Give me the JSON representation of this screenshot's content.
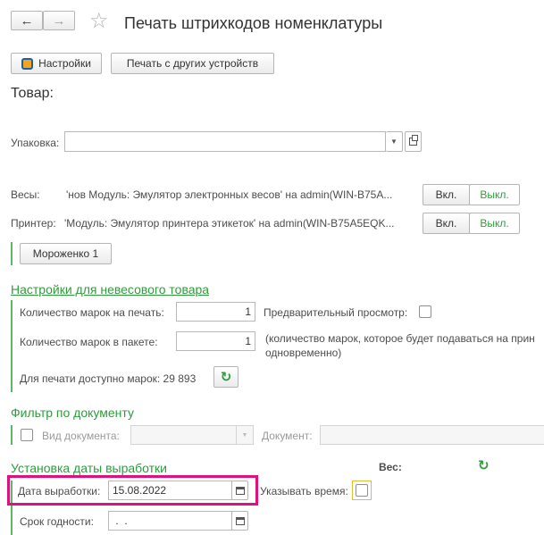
{
  "header": {
    "back_glyph": "←",
    "forward_glyph": "→",
    "star_glyph": "☆",
    "title": "Печать штрихкодов номенклатуры"
  },
  "toolbar": {
    "settings_label": "Настройки",
    "print_other_label": "Печать с других устройств"
  },
  "product": {
    "title": "Товар:"
  },
  "packaging": {
    "label": "Упаковка:",
    "value": ""
  },
  "scales": {
    "label": "Весы:",
    "value": "'нов Модуль: Эмулятор электронных весов' на admin(WIN-B75A...",
    "on_label": "Вкл.",
    "off_label": "Выкл."
  },
  "printer": {
    "label": "Принтер:",
    "value": "'Модуль: Эмулятор принтера этикеток' на admin(WIN-B75A5EQK...",
    "on_label": "Вкл.",
    "off_label": "Выкл."
  },
  "template_button": "Мороженко 1",
  "nonweight": {
    "title": "Настройки для невесового товара",
    "marks_label": "Количество марок на печать:",
    "marks_value": "1",
    "preview_label": "Предварительный просмотр:",
    "pack_label": "Количество марок в пакете:",
    "pack_value": "1",
    "pack_note_line1": "(количество марок, которое будет подаваться на прин",
    "pack_note_line2": "одновременно)",
    "available_label": "Для печати доступно марок: 29 893",
    "refresh_glyph": "↻"
  },
  "filter": {
    "title": "Фильтр по документу",
    "doc_type_label": "Вид документа:",
    "doc_type_value": "",
    "doc_label": "Документ:",
    "doc_value": ""
  },
  "production": {
    "title": "Установка даты выработки",
    "weight_label": "Вес:",
    "refresh_glyph": "↻",
    "date_label": "Дата выработки:",
    "date_value": "15.08.2022",
    "time_label": "Указывать время:",
    "shelf_label": "Срок годности:",
    "shelf_value": " .  ."
  },
  "colors": {
    "accent_green": "#2f9c3c",
    "highlight_magenta": "#e0117c",
    "checkbox_yellow": "#e8b83a"
  }
}
